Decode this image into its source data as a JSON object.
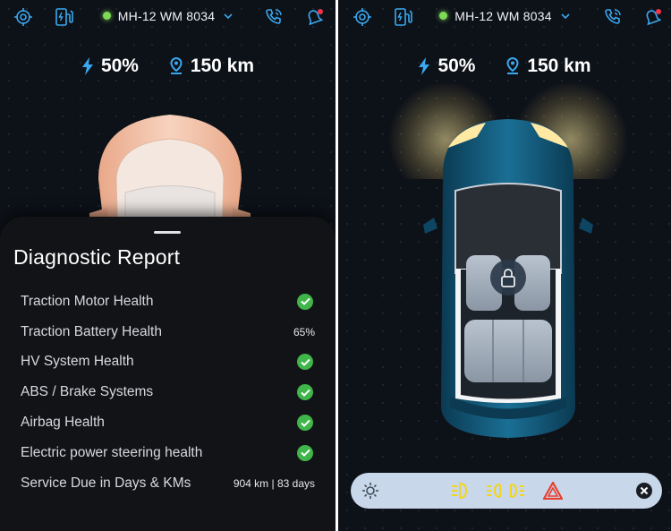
{
  "vehicle": {
    "plate": "MH-12 WM 8034",
    "battery": "50%",
    "range": "150 km"
  },
  "report": {
    "title": "Diagnostic Report",
    "items": [
      {
        "label": "Traction Motor Health",
        "status": "ok"
      },
      {
        "label": "Traction Battery Health",
        "value": "65%"
      },
      {
        "label": "HV System Health",
        "status": "ok"
      },
      {
        "label": "ABS / Brake Systems",
        "status": "ok"
      },
      {
        "label": "Airbag Health",
        "status": "ok"
      },
      {
        "label": "Electric power steering health",
        "status": "ok"
      },
      {
        "label": "Service Due in Days & KMs",
        "value": "904 km | 83 days"
      }
    ]
  },
  "icons": {
    "topbar": [
      "locate-icon",
      "charging-station-icon",
      "status-dot",
      "chevron-down-icon",
      "phone-call-icon",
      "alert-bell-icon"
    ],
    "stats": [
      "lightning-icon",
      "location-pin-icon"
    ],
    "controls": [
      "light-settings-icon",
      "headlight-icon",
      "parking-lights-icon",
      "hazard-icon",
      "close-icon"
    ]
  },
  "colors": {
    "accent": "#3aa8f0",
    "ok": "#3fb54a",
    "status_dot": "#7ed957",
    "hazard": "#e8412f",
    "light_active": "#f2d51e",
    "bell_badge": "#f2344a"
  }
}
